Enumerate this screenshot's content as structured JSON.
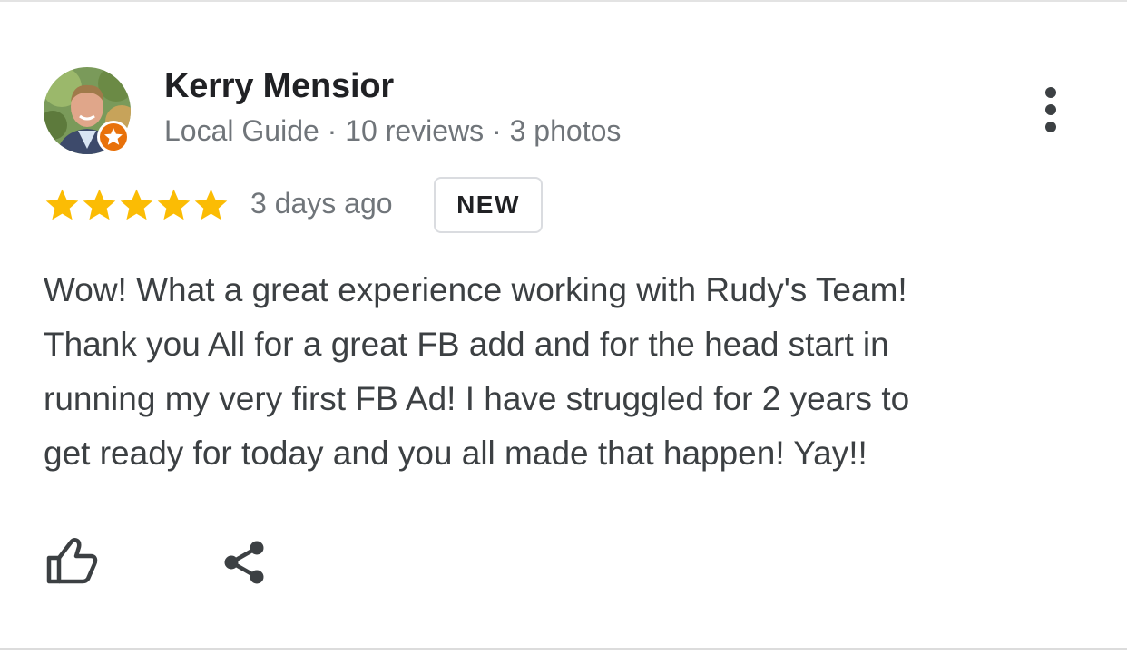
{
  "review": {
    "author_name": "Kerry Mensior",
    "author_meta": "Local Guide · 10 reviews · 3 photos",
    "rating": 5,
    "rating_max": 5,
    "date": "3 days ago",
    "badge": "NEW",
    "text_lines": [
      "Wow! What a great experience working with Rudy's Team!",
      "Thank you All for a great FB add and for the head start in",
      "running my very first FB Ad! I have struggled for 2 years to",
      "get ready for today and you all made that happen! Yay!!"
    ]
  },
  "icons": {
    "avatar": "profile-photo",
    "guide_badge": "local-guide-star-icon",
    "more": "more-vertical-icon",
    "star": "star-icon",
    "like": "thumbs-up-icon",
    "share": "share-icon"
  },
  "colors": {
    "star": "#fbbc04",
    "guide_badge": "#e8710a",
    "name": "#202124",
    "meta": "#70757a",
    "body_text": "#3c4043",
    "icon": "#3c4043",
    "badge_border": "#dadce0"
  }
}
